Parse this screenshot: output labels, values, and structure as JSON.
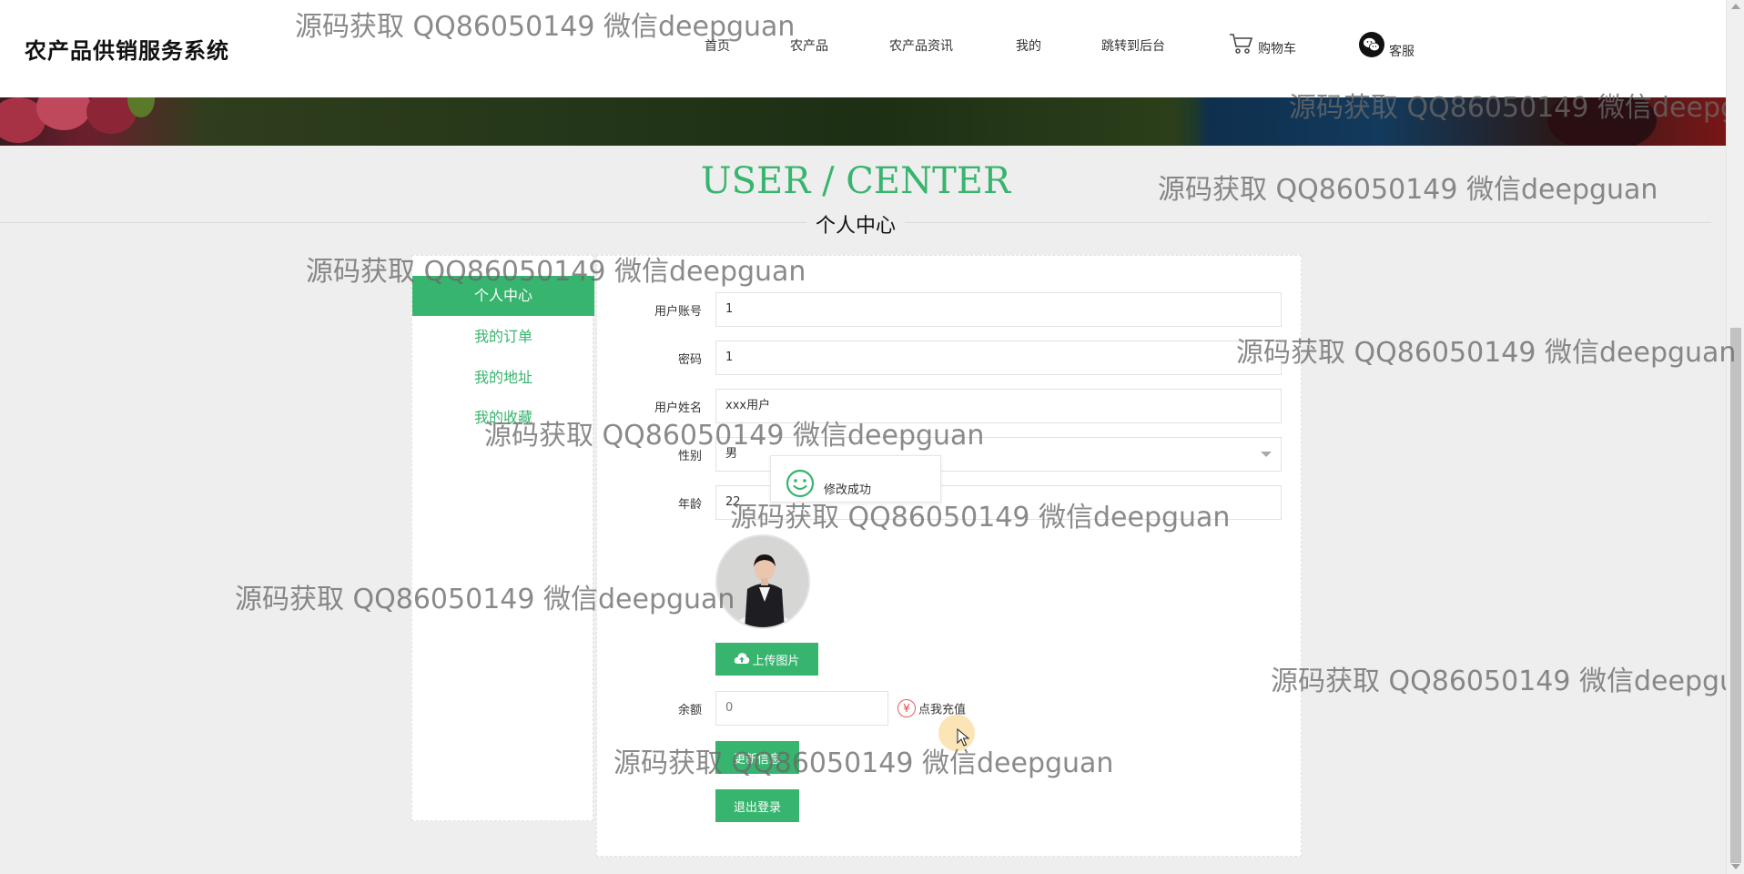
{
  "header": {
    "brand": "农产品供销服务系统",
    "nav": [
      {
        "label": "首页",
        "icon": null
      },
      {
        "label": "农产品",
        "icon": null
      },
      {
        "label": "农产品资讯",
        "icon": null
      },
      {
        "label": "我的",
        "icon": null
      },
      {
        "label": "跳转到后台",
        "icon": null
      },
      {
        "label": "购物车",
        "icon": "cart-icon"
      },
      {
        "label": "客服",
        "icon": "wechat-icon"
      }
    ]
  },
  "section": {
    "title_en": "USER / CENTER",
    "title_cn": "个人中心"
  },
  "sidebar": {
    "items": [
      {
        "label": "个人中心",
        "active": true
      },
      {
        "label": "我的订单",
        "active": false
      },
      {
        "label": "我的地址",
        "active": false
      },
      {
        "label": "我的收藏",
        "active": false
      }
    ]
  },
  "form": {
    "account_label": "用户账号",
    "account_value": "1",
    "password_label": "密码",
    "password_value": "1",
    "name_label": "用户姓名",
    "name_value": "xxx用户",
    "gender_label": "性别",
    "gender_value": "男",
    "age_label": "年龄",
    "age_value": "22",
    "upload_label": "上传图片",
    "balance_label": "余额",
    "balance_value": "0",
    "recharge_label": "点我充值",
    "update_label": "更新信息",
    "logout_label": "退出登录"
  },
  "toast": {
    "message": "修改成功"
  },
  "watermark": "源码获取 QQ86050149 微信deepguan",
  "colors": {
    "accent": "#37b46e",
    "background": "#eeeeee",
    "panel": "#ffffff"
  }
}
